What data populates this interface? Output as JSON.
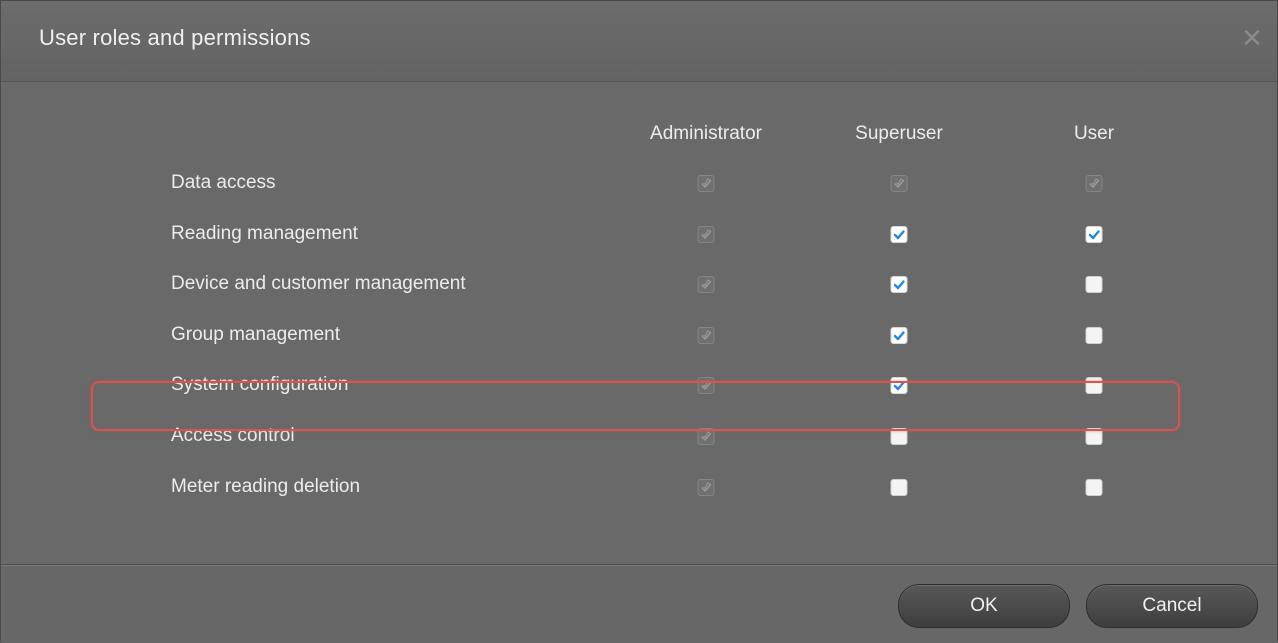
{
  "dialog": {
    "title": "User roles and permissions",
    "close_glyph": "✕"
  },
  "columns": [
    {
      "label": "Administrator"
    },
    {
      "label": "Superuser"
    },
    {
      "label": "User"
    }
  ],
  "rows": [
    {
      "label": "Data access",
      "states": [
        "disabled",
        "disabled",
        "disabled"
      ]
    },
    {
      "label": "Reading management",
      "states": [
        "disabled",
        "checked",
        "checked"
      ]
    },
    {
      "label": "Device and customer management",
      "states": [
        "disabled",
        "checked",
        "unchecked"
      ]
    },
    {
      "label": "Group management",
      "states": [
        "disabled",
        "checked",
        "unchecked"
      ]
    },
    {
      "label": "System configuration",
      "states": [
        "disabled",
        "checked",
        "unchecked"
      ]
    },
    {
      "label": "Access control",
      "states": [
        "disabled",
        "unchecked",
        "unchecked"
      ]
    },
    {
      "label": "Meter reading deletion",
      "states": [
        "disabled",
        "unchecked",
        "unchecked"
      ],
      "highlighted": true
    }
  ],
  "footer": {
    "ok_label": "OK",
    "cancel_label": "Cancel"
  },
  "colors": {
    "checkmark": "#1e88e5",
    "highlight": "#d9544f",
    "background": "#696969"
  }
}
